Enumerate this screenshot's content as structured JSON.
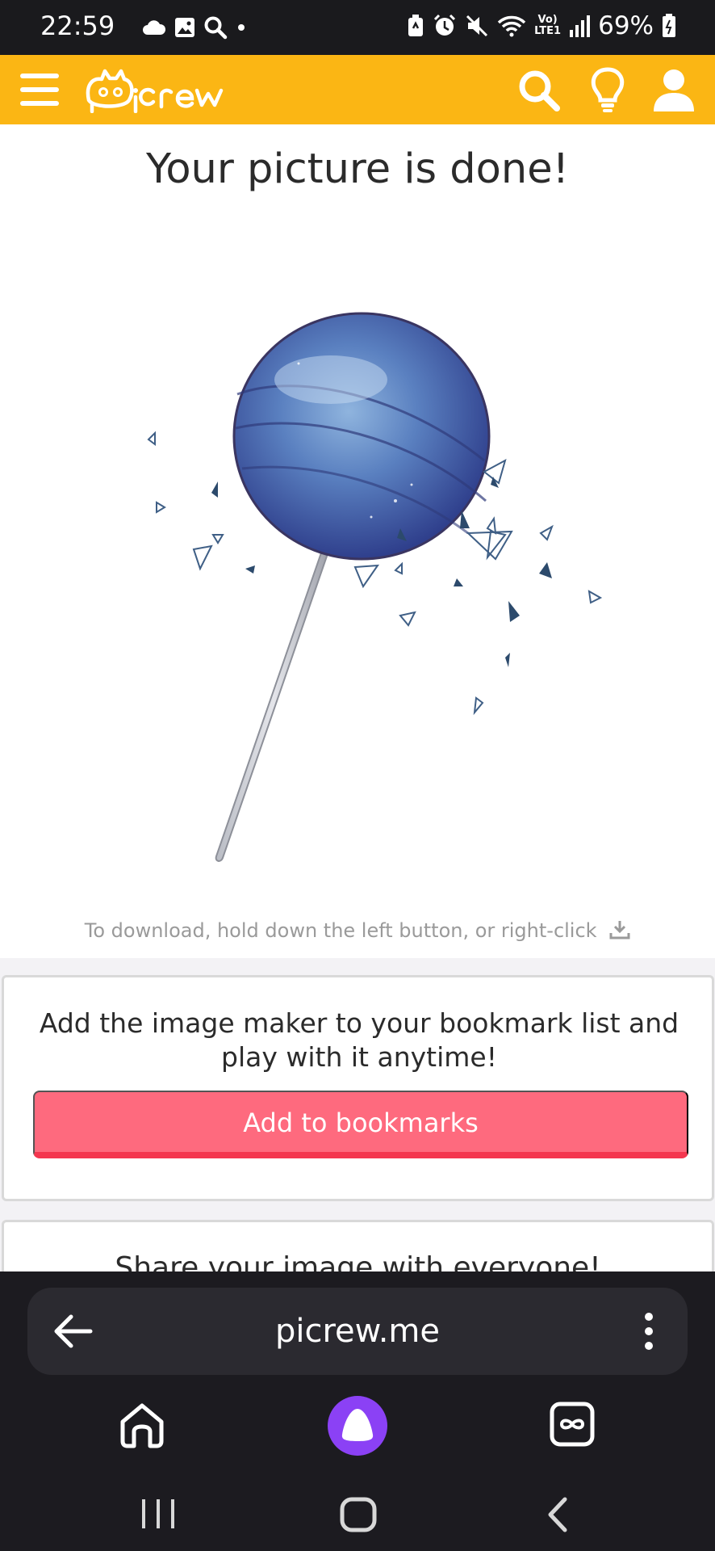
{
  "status_bar": {
    "time": "22:59",
    "left_icons": [
      "cloud-icon",
      "image-icon",
      "search-icon",
      "dot-icon"
    ],
    "right_icons": [
      "battery-saver-icon",
      "alarm-icon",
      "mute-icon",
      "wifi-icon",
      "volte-lte-icon",
      "signal-icon"
    ],
    "volte_label_top": "Vo)",
    "volte_label_bottom": "LTE1",
    "battery": "69%"
  },
  "app_header": {
    "brand": "Picrew",
    "background": "#fbb614",
    "icons": [
      "menu-icon",
      "search-icon",
      "lightbulb-icon",
      "user-icon"
    ]
  },
  "page": {
    "title": "Your picture is done!",
    "image_alt": "Blue galaxy lollipop",
    "download_hint": "To download, hold down the left button, or right-click"
  },
  "bookmark_card": {
    "text": "Add the image maker to your bookmark list and play with it anytime!",
    "button_label": "Add to bookmarks",
    "button_color": "#fe6a7e"
  },
  "share_card": {
    "title": "Share your image with everyone!"
  },
  "browser": {
    "url": "picrew.me",
    "icons": [
      "back-arrow-icon",
      "more-vertical-icon",
      "home-icon",
      "assistant-icon",
      "tabs-icon"
    ],
    "assistant_color": "#8b41f5"
  },
  "system_nav": {
    "icons": [
      "recent-apps-icon",
      "home-icon",
      "back-icon"
    ]
  }
}
